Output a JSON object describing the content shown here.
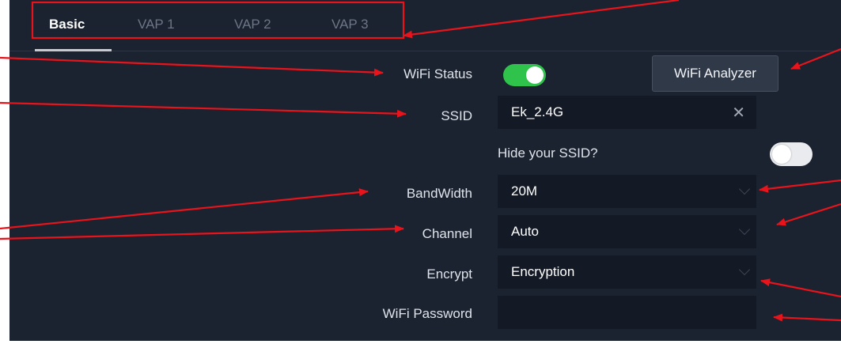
{
  "tabs": [
    {
      "label": "Basic",
      "active": true
    },
    {
      "label": "VAP 1",
      "active": false
    },
    {
      "label": "VAP 2",
      "active": false
    },
    {
      "label": "VAP 3",
      "active": false
    }
  ],
  "form": {
    "wifi_status": {
      "label": "WiFi Status",
      "enabled": true
    },
    "analyzer_button": "WiFi Analyzer",
    "ssid": {
      "label": "SSID",
      "value": "Ek_2.4G",
      "clear_icon": "✕"
    },
    "hide_ssid": {
      "label": "Hide your SSID?",
      "enabled": false
    },
    "bandwidth": {
      "label": "BandWidth",
      "value": "20M"
    },
    "channel": {
      "label": "Channel",
      "value": "Auto"
    },
    "encrypt": {
      "label": "Encrypt",
      "value": "Encryption"
    },
    "wifi_password": {
      "label": "WiFi Password",
      "value": ""
    }
  },
  "colors": {
    "panel_bg": "#1b2230",
    "field_bg": "#141a25",
    "toggle_on": "#2fc34b",
    "annotation_red": "#e8141c"
  },
  "icons": {
    "clear": "close-icon",
    "dropdown": "chevron-down-icon"
  }
}
